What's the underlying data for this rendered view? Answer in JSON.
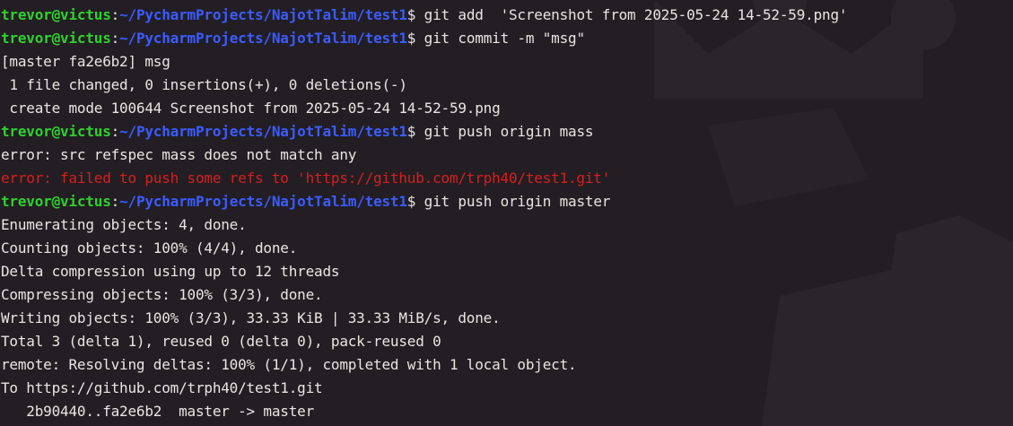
{
  "colors": {
    "background": "#231e23",
    "user": "#2ed12e",
    "path": "#3b5cff",
    "text": "#e8e6e3",
    "error": "#d81e1e"
  },
  "prompt": {
    "user_host": "trevor@victus",
    "separator": ":",
    "path": "~/PycharmProjects/NajotTalim/test1",
    "symbol": "$ "
  },
  "lines": [
    {
      "type": "cmd",
      "text": "git add  'Screenshot from 2025-05-24 14-52-59.png'"
    },
    {
      "type": "cmd",
      "text": "git commit -m \"msg\""
    },
    {
      "type": "out",
      "text": "[master fa2e6b2] msg"
    },
    {
      "type": "out",
      "text": " 1 file changed, 0 insertions(+), 0 deletions(-)"
    },
    {
      "type": "out",
      "text": " create mode 100644 Screenshot from 2025-05-24 14-52-59.png"
    },
    {
      "type": "cmd",
      "text": "git push origin mass"
    },
    {
      "type": "out",
      "text": "error: src refspec mass does not match any"
    },
    {
      "type": "err",
      "text": "error: failed to push some refs to 'https://github.com/trph40/test1.git'"
    },
    {
      "type": "cmd",
      "text": "git push origin master"
    },
    {
      "type": "out",
      "text": "Enumerating objects: 4, done."
    },
    {
      "type": "out",
      "text": "Counting objects: 100% (4/4), done."
    },
    {
      "type": "out",
      "text": "Delta compression using up to 12 threads"
    },
    {
      "type": "out",
      "text": "Compressing objects: 100% (3/3), done."
    },
    {
      "type": "out",
      "text": "Writing objects: 100% (3/3), 33.33 KiB | 33.33 MiB/s, done."
    },
    {
      "type": "out",
      "text": "Total 3 (delta 1), reused 0 (delta 0), pack-reused 0"
    },
    {
      "type": "out",
      "text": "remote: Resolving deltas: 100% (1/1), completed with 1 local object."
    },
    {
      "type": "out",
      "text": "To https://github.com/trph40/test1.git"
    },
    {
      "type": "out",
      "text": "   2b90440..fa2e6b2  master -> master"
    }
  ]
}
